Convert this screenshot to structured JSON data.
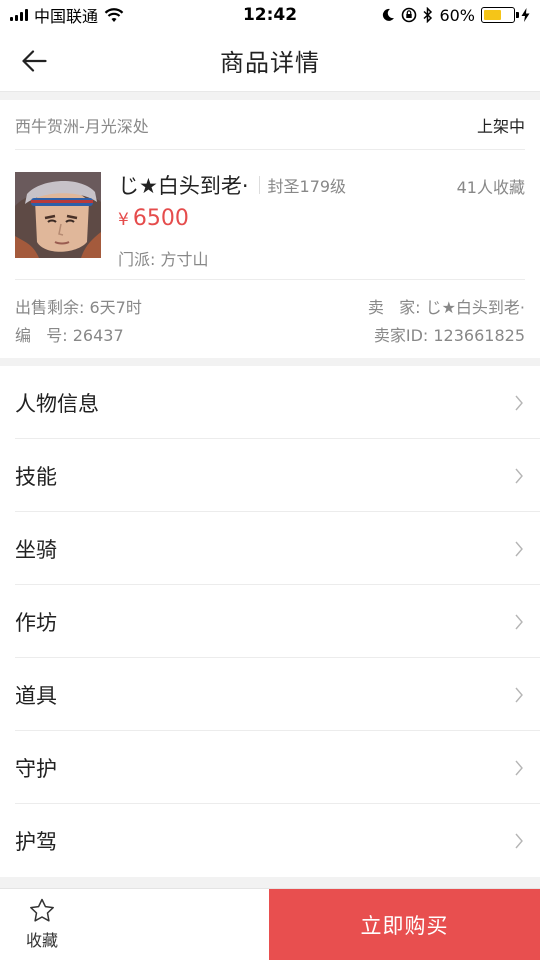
{
  "status_bar": {
    "carrier": "中国联通",
    "time": "12:42",
    "battery_text": "60%",
    "battery_level": 0.6
  },
  "nav": {
    "title": "商品详情"
  },
  "product": {
    "server": "西牛贺洲-月光深处",
    "status": "上架中",
    "name": "じ★白头到老·",
    "level": "封圣179级",
    "favorites": "41人收藏",
    "price_symbol": "¥",
    "price": "6500",
    "school": "门派: 方寸山",
    "time_left": "出售剩余: 6天7时",
    "serial": "编   号: 26437",
    "seller": "卖   家: じ★白头到老·",
    "seller_id": "卖家ID: 123661825"
  },
  "menu": [
    {
      "label": "人物信息"
    },
    {
      "label": "技能"
    },
    {
      "label": "坐骑"
    },
    {
      "label": "作坊"
    },
    {
      "label": "道具"
    },
    {
      "label": "守护"
    },
    {
      "label": "护驾"
    }
  ],
  "bottom": {
    "favorite_label": "收藏",
    "buy_label": "立即购买"
  },
  "colors": {
    "accent": "#e84f4f",
    "price": "#e54c4c"
  }
}
